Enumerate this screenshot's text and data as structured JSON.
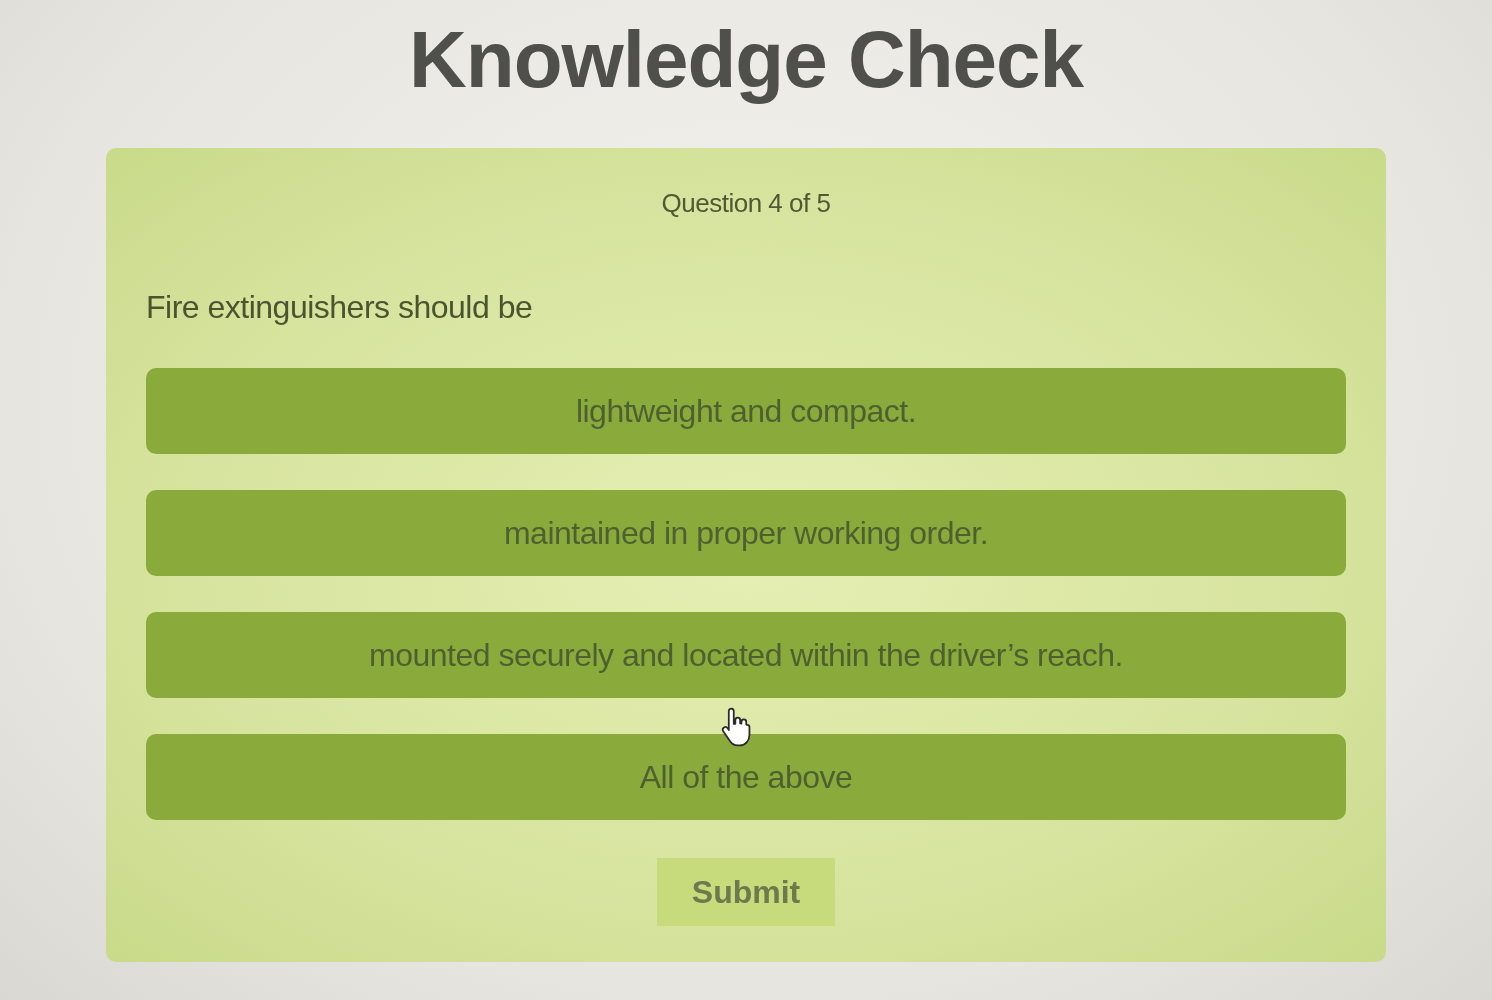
{
  "heading": "Knowledge Check",
  "quiz": {
    "progress": "Question 4 of 5",
    "question": "Fire extinguishers should be",
    "options": [
      {
        "label": "lightweight and compact.",
        "selected": false
      },
      {
        "label": "maintained in proper working order.",
        "selected": false
      },
      {
        "label": "mounted securely and located within the driver’s reach.",
        "selected": false
      },
      {
        "label": "All of the above",
        "selected": false
      }
    ],
    "submit": {
      "label": "Submit",
      "disabled": true
    }
  }
}
